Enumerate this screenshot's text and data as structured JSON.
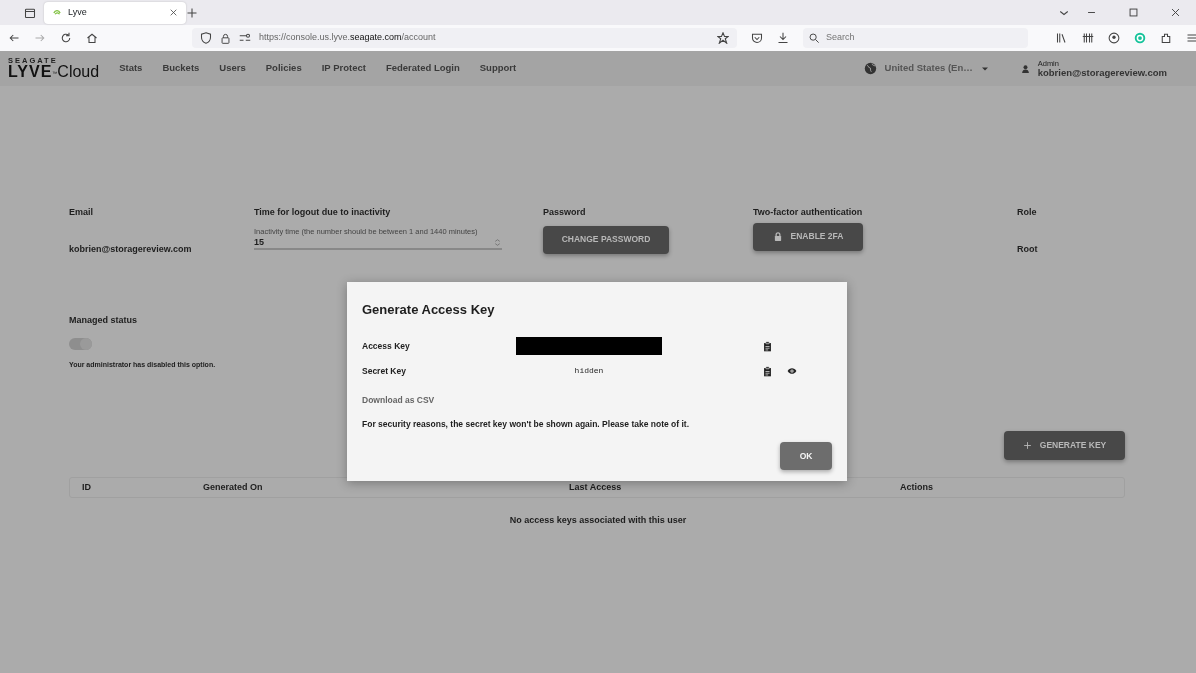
{
  "browser": {
    "tabs": [
      {
        "title": "Lyve",
        "selected": true
      }
    ],
    "url": {
      "host": "https://console.us.lyve.",
      "domain": "seagate.com",
      "path": "/account"
    },
    "search": {
      "placeholder": "Search"
    }
  },
  "app": {
    "logo": {
      "brand": "SEAGATE",
      "name": "LYVE",
      "tm": "™",
      "product": "Cloud"
    },
    "nav": [
      {
        "label": "Stats"
      },
      {
        "label": "Buckets"
      },
      {
        "label": "Users"
      },
      {
        "label": "Policies"
      },
      {
        "label": "IP Protect"
      },
      {
        "label": "Federated Login"
      },
      {
        "label": "Support"
      }
    ],
    "region": "United States (En…",
    "user": {
      "role": "Admin",
      "email": "kobrien@storagereview.com"
    }
  },
  "account": {
    "email": {
      "label": "Email",
      "value": "kobrien@storagereview.com"
    },
    "inactivity": {
      "label": "Time for logout due to inactivity",
      "hint": "Inactivity time (the number should be between 1 and 1440 minutes)",
      "value": "15"
    },
    "password": {
      "label": "Password",
      "button": "CHANGE PASSWORD"
    },
    "two_factor": {
      "label": "Two-factor authentication",
      "button": "ENABLE 2FA"
    },
    "role": {
      "label": "Role",
      "value": "Root"
    },
    "managed": {
      "label": "Managed status",
      "on": true,
      "disabled": true,
      "note": "Your administrator has disabled this option."
    }
  },
  "generate_button": "GENERATE KEY",
  "table": {
    "columns": [
      "ID",
      "Generated On",
      "Last Access",
      "Actions"
    ],
    "empty": "No access keys associated with this user"
  },
  "modal": {
    "title": "Generate Access Key",
    "rows": [
      {
        "label": "Access Key",
        "kind": "redacted",
        "reveal": false
      },
      {
        "label": "Secret Key",
        "kind": "text",
        "value": "hidden",
        "reveal": true
      }
    ],
    "download": "Download as CSV",
    "note": "For security reasons, the secret key won't be shown again. Please take note of it.",
    "ok": "OK"
  }
}
